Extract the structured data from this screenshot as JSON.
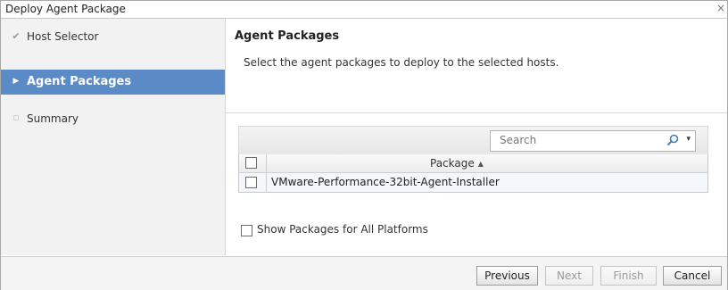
{
  "dialog": {
    "title": "Deploy Agent Package",
    "close_glyph": "×"
  },
  "sidebar": {
    "steps": [
      {
        "label": "Host Selector",
        "state": "done",
        "icon": "check-icon",
        "glyph": "✔"
      },
      {
        "label": "Agent Packages",
        "state": "active",
        "icon": "triangle-right-icon",
        "glyph": "▶"
      },
      {
        "label": "Summary",
        "state": "pending",
        "icon": "circle-outline-icon",
        "glyph": "▢"
      }
    ]
  },
  "main": {
    "heading": "Agent Packages",
    "description": "Select the agent packages to deploy to the selected hosts.",
    "search": {
      "placeholder": "Search",
      "dropdown_glyph": "▾"
    },
    "table": {
      "column_header": "Package",
      "sort_glyph": "▲",
      "rows": [
        {
          "package": "VMware-Performance-32bit-Agent-Installer",
          "checked": false
        }
      ]
    },
    "show_all_label": "Show Packages for All Platforms"
  },
  "footer": {
    "buttons": [
      {
        "label": "Previous",
        "enabled": true
      },
      {
        "label": "Next",
        "enabled": false
      },
      {
        "label": "Finish",
        "enabled": false
      },
      {
        "label": "Cancel",
        "enabled": true
      }
    ]
  },
  "colors": {
    "accent": "#5b8bc7",
    "sidebar_bg": "#f2f2f2",
    "search_icon": "#3a7fc4"
  }
}
